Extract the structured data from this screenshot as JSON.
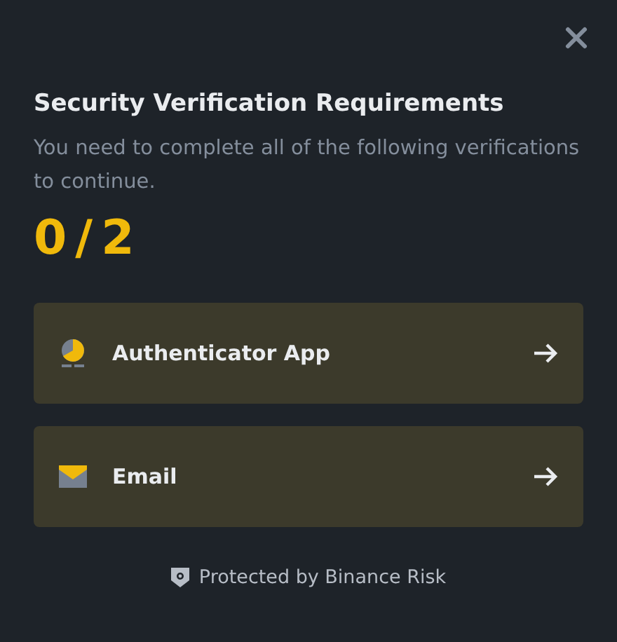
{
  "title": "Security Verification Requirements",
  "description": "You need to complete all of the following verifications to continue.",
  "progress": "0/2",
  "methods": [
    {
      "kind": "authenticator",
      "label": "Authenticator App"
    },
    {
      "kind": "email",
      "label": "Email"
    }
  ],
  "footer": "Protected by Binance Risk"
}
